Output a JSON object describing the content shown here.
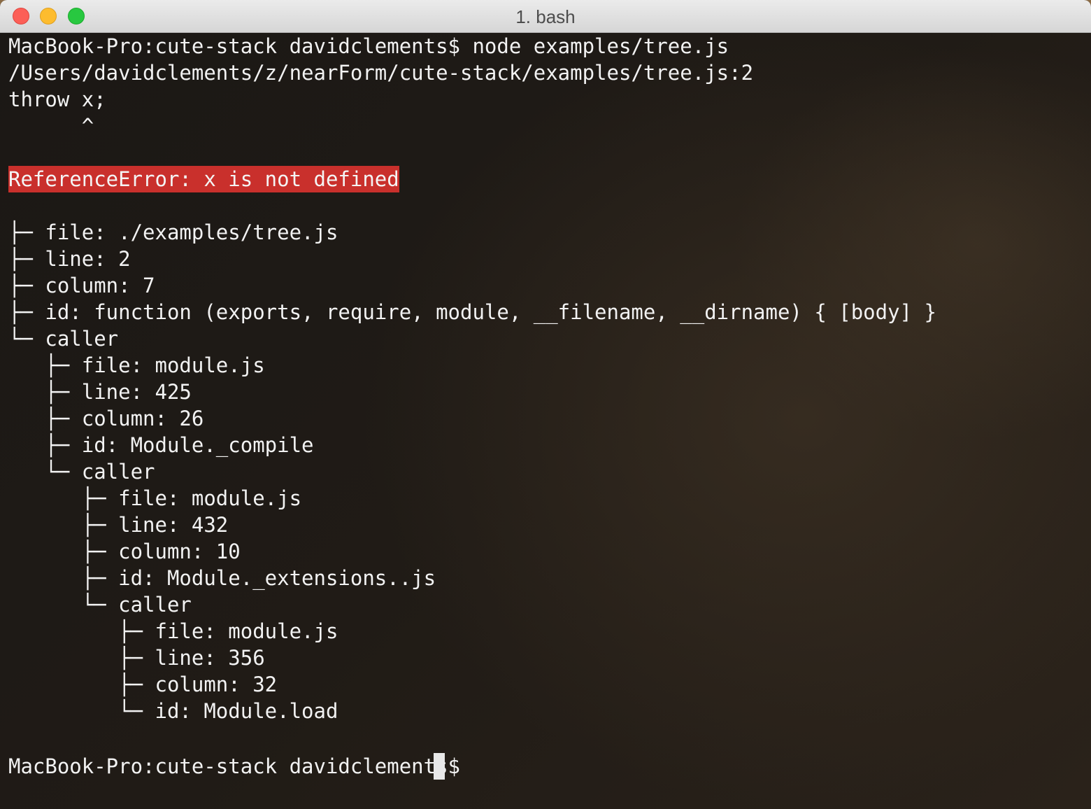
{
  "window": {
    "title": "1. bash"
  },
  "colors": {
    "error_bg": "#c9302c",
    "text": "#f2f2f2",
    "background": "#1a1714"
  },
  "terminal": {
    "lines": [
      "MacBook-Pro:cute-stack davidclements$ node examples/tree.js",
      "/Users/davidclements/z/nearForm/cute-stack/examples/tree.js:2",
      "throw x;",
      "      ^",
      "",
      "ReferenceError: x is not defined",
      "",
      "├─ file: ./examples/tree.js",
      "├─ line: 2",
      "├─ column: 7",
      "├─ id: function (exports, require, module, __filename, __dirname) { [body] }",
      "└─ caller",
      "   ├─ file: module.js",
      "   ├─ line: 425",
      "   ├─ column: 26",
      "   ├─ id: Module._compile",
      "   └─ caller",
      "      ├─ file: module.js",
      "      ├─ line: 432",
      "      ├─ column: 10",
      "      ├─ id: Module._extensions..js",
      "      └─ caller",
      "         ├─ file: module.js",
      "         ├─ line: 356",
      "         ├─ column: 32",
      "         └─ id: Module.load",
      "",
      "MacBook-Pro:cute-stack davidclements$ "
    ]
  }
}
